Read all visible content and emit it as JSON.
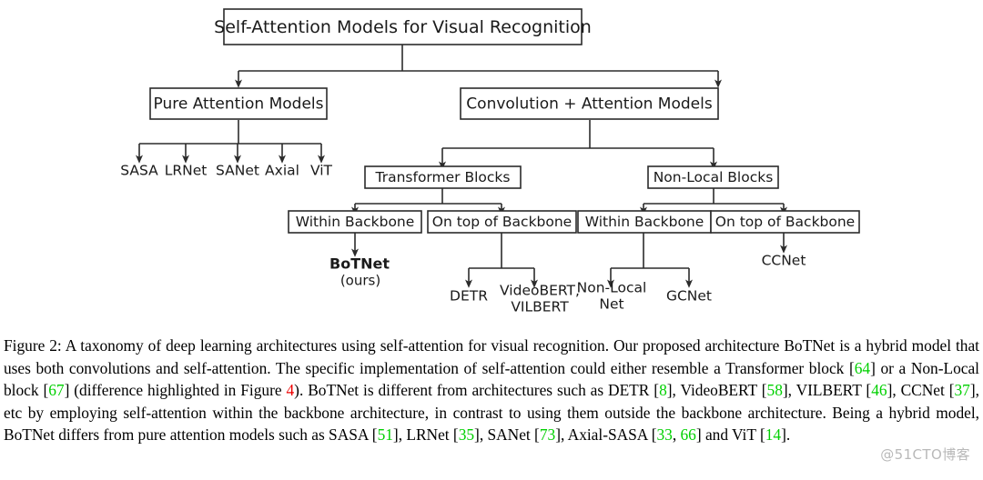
{
  "figure": {
    "label": "Figure 2",
    "diagram": {
      "root": {
        "label": "Self-Attention Models for Visual Recognition"
      },
      "level1": [
        {
          "label": "Pure Attention Models"
        },
        {
          "label": "Convolution + Attention Models"
        }
      ],
      "pure_attention_leaves": [
        {
          "label": "SASA"
        },
        {
          "label": "LRNet"
        },
        {
          "label": "SANet"
        },
        {
          "label": "Axial"
        },
        {
          "label": "ViT"
        }
      ],
      "block_types": [
        {
          "label": "Transformer Blocks"
        },
        {
          "label": "Non-Local Blocks"
        }
      ],
      "placements": [
        {
          "label": "Within Backbone"
        },
        {
          "label": "On top of Backbone"
        },
        {
          "label": "Within Backbone"
        },
        {
          "label": "On top of Backbone"
        }
      ],
      "models": [
        {
          "label": "BoTNet",
          "sub": "(ours)",
          "bold": true
        },
        {
          "label": "DETR",
          "bold": false
        },
        {
          "label": "VideoBERT,",
          "sub": "VILBERT",
          "bold": false
        },
        {
          "label": "Non-Local",
          "sub": "Net",
          "bold": false
        },
        {
          "label": "GCNet",
          "bold": false
        },
        {
          "label": "CCNet",
          "bold": false
        }
      ]
    },
    "caption": {
      "prefix": "Figure 2:",
      "segments": [
        {
          "text": " A taxonomy of deep learning architectures using self-attention for visual recognition. Our proposed architecture BoTNet is a hybrid model that uses both convolutions and self-attention. The specific implementation of self-attention could either resemble a Transformer block [",
          "style": "plain"
        },
        {
          "text": "64",
          "style": "green"
        },
        {
          "text": "] or a Non-Local block [",
          "style": "plain"
        },
        {
          "text": "67",
          "style": "green"
        },
        {
          "text": "] (difference highlighted in Figure ",
          "style": "plain"
        },
        {
          "text": "4",
          "style": "red"
        },
        {
          "text": "). BoTNet is different from architectures such as DETR [",
          "style": "plain"
        },
        {
          "text": "8",
          "style": "green"
        },
        {
          "text": "], VideoBERT [",
          "style": "plain"
        },
        {
          "text": "58",
          "style": "green"
        },
        {
          "text": "], VILBERT [",
          "style": "plain"
        },
        {
          "text": "46",
          "style": "green"
        },
        {
          "text": "], CCNet [",
          "style": "plain"
        },
        {
          "text": "37",
          "style": "green"
        },
        {
          "text": "], etc by employing self-attention within the backbone architecture, in contrast to using them outside the backbone architecture. Being a hybrid model, BoTNet differs from pure attention models such as SASA [",
          "style": "plain"
        },
        {
          "text": "51",
          "style": "green"
        },
        {
          "text": "], LRNet [",
          "style": "plain"
        },
        {
          "text": "35",
          "style": "green"
        },
        {
          "text": "], SANet [",
          "style": "plain"
        },
        {
          "text": "73",
          "style": "green"
        },
        {
          "text": "], Axial-SASA [",
          "style": "plain"
        },
        {
          "text": "33",
          "style": "green"
        },
        {
          "text": ", ",
          "style": "plain"
        },
        {
          "text": "66",
          "style": "green"
        },
        {
          "text": "] and ViT [",
          "style": "plain"
        },
        {
          "text": "14",
          "style": "green"
        },
        {
          "text": "].",
          "style": "plain"
        }
      ]
    },
    "watermark": {
      "text": "@51CTO博客"
    },
    "colors": {
      "reference_green": "#00d000",
      "reference_red": "#ee0000",
      "stroke": "#2b2b2b",
      "watermark_gray": "#b9b9b9"
    }
  }
}
